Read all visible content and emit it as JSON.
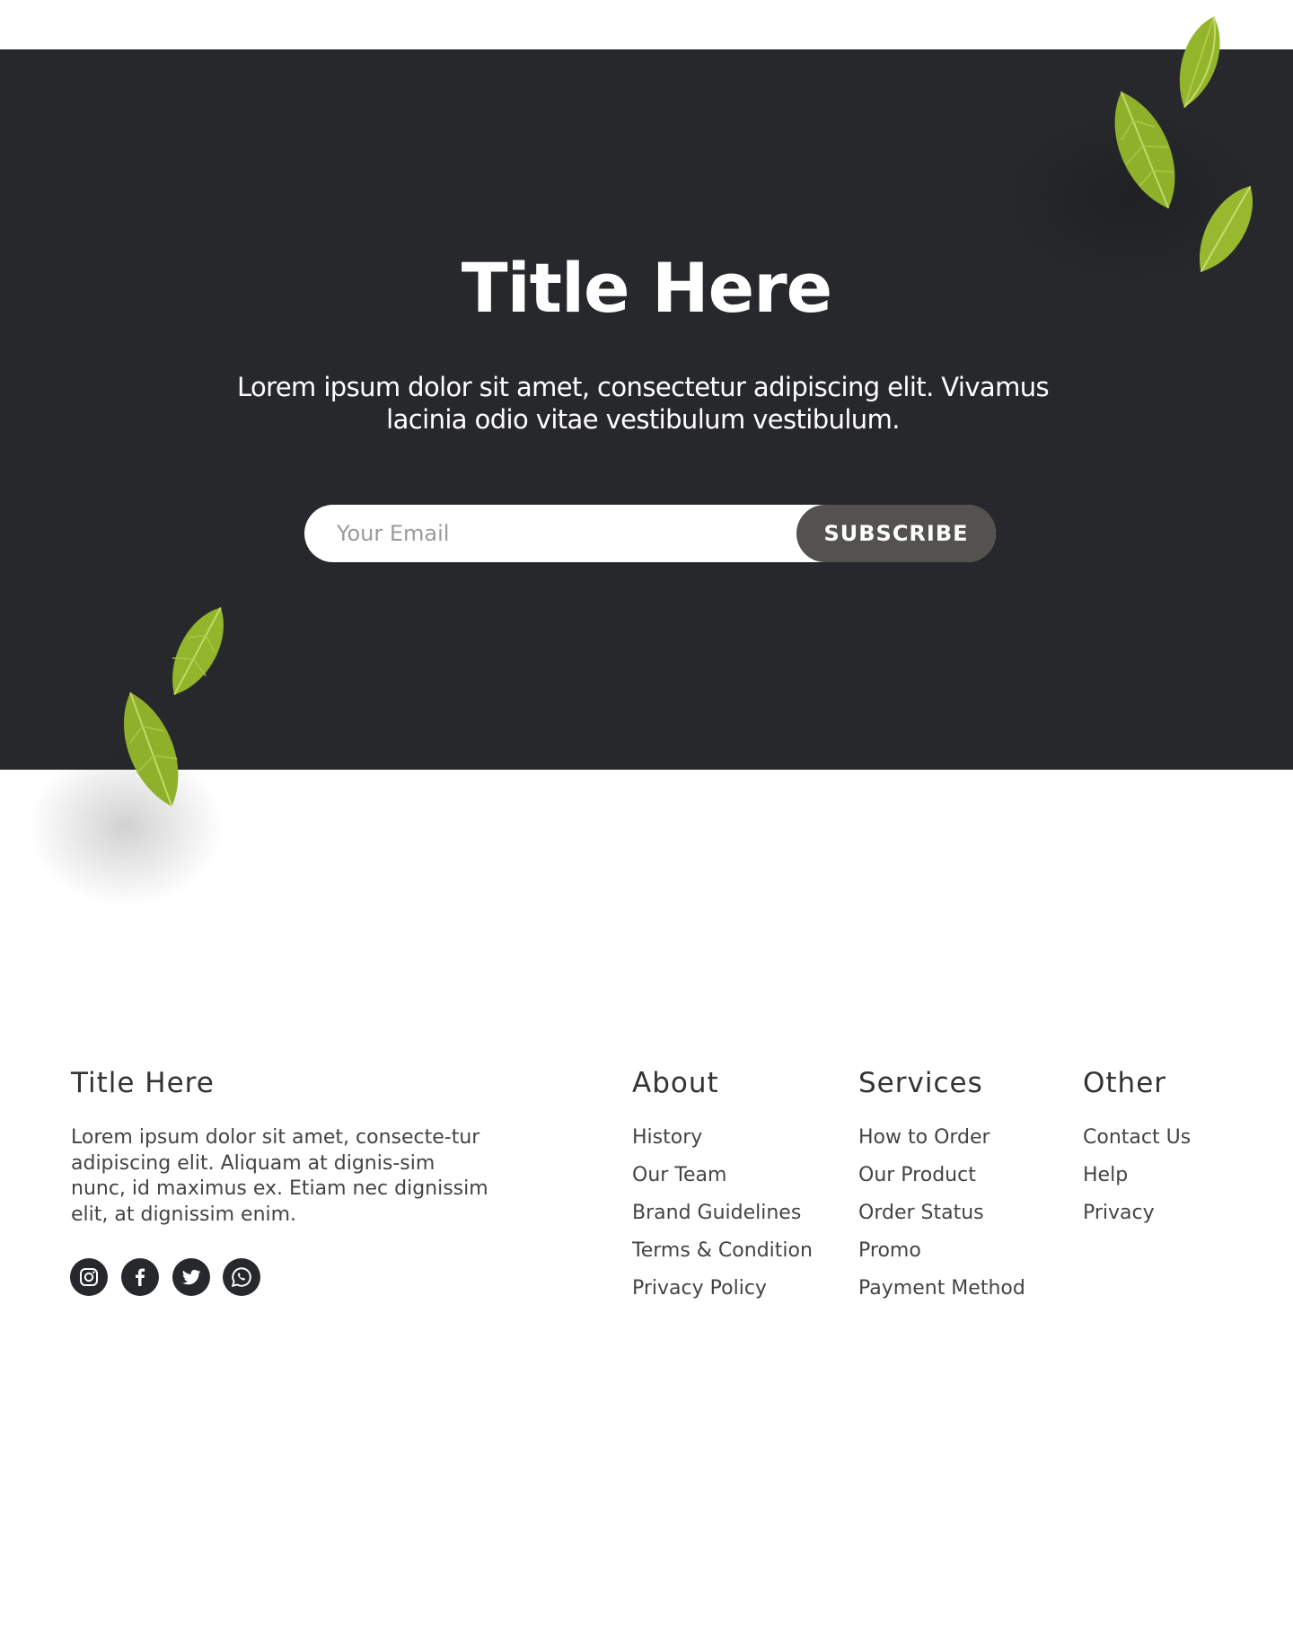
{
  "hero": {
    "title": "Title Here",
    "subtitle": "Lorem ipsum dolor sit amet, consectetur adipiscing elit. Vivamus lacinia odio vitae vestibulum vestibulum.",
    "email_placeholder": "Your Email",
    "subscribe_label": "SUBSCRIBE",
    "background_color": "#27282c",
    "button_color": "#54524e"
  },
  "footer": {
    "brand_title": "Title Here",
    "description": "Lorem ipsum dolor sit amet, consecte-tur adipiscing elit. Aliquam at dignis-sim nunc, id maximus ex. Etiam nec dignissim elit, at dignissim enim.",
    "social_icons": [
      "instagram-icon",
      "facebook-icon",
      "twitter-icon",
      "whatsapp-icon"
    ],
    "columns": [
      {
        "title": "About",
        "items": [
          "History",
          "Our Team",
          "Brand Guidelines",
          "Terms & Condition",
          "Privacy Policy"
        ]
      },
      {
        "title": "Services",
        "items": [
          "How to Order",
          "Our Product",
          "Order Status",
          "Promo",
          "Payment Method"
        ]
      },
      {
        "title": "Other",
        "items": [
          "Contact Us",
          "Help",
          "Privacy"
        ]
      }
    ]
  }
}
